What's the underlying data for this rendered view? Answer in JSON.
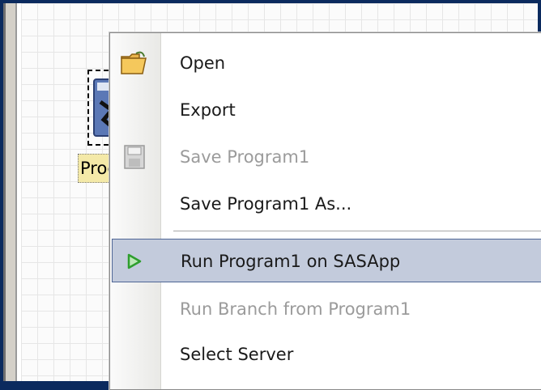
{
  "task_node": {
    "label": "Prog"
  },
  "menu": {
    "items": [
      {
        "label": "Open",
        "icon": "open-folder-icon",
        "enabled": true
      },
      {
        "label": "Export",
        "icon": "",
        "enabled": true
      },
      {
        "label": "Save Program1",
        "icon": "save-disk-icon",
        "enabled": false
      },
      {
        "label": "Save Program1 As...",
        "icon": "",
        "enabled": true
      },
      {
        "label": "Run Program1 on SASApp",
        "icon": "run-play-icon",
        "enabled": true,
        "highlighted": true
      },
      {
        "label": "Run Branch from Program1",
        "icon": "",
        "enabled": false
      },
      {
        "label": "Select Server",
        "icon": "",
        "enabled": true
      }
    ]
  },
  "colors": {
    "highlight_fill": "#c3cbdc",
    "highlight_border": "#4e6595",
    "run_icon": "#2e9e2e",
    "disabled_text": "#9b9b9b"
  }
}
